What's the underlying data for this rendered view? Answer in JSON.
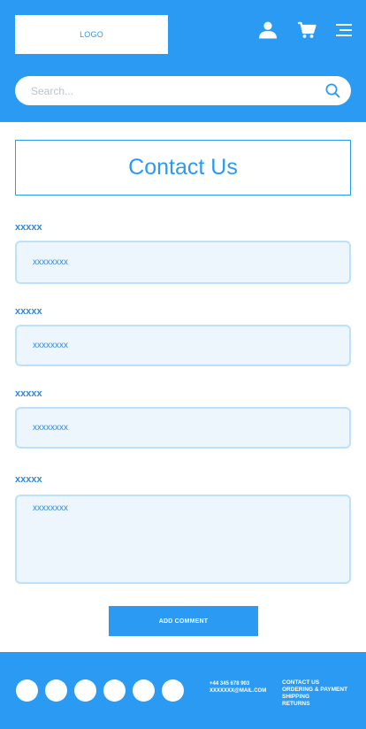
{
  "header": {
    "logo_text": "LOGO",
    "icons": [
      "user-icon",
      "cart-icon",
      "menu-icon"
    ],
    "search": {
      "placeholder": "Search..."
    }
  },
  "main": {
    "title": "Contact Us",
    "fields": [
      {
        "label": "xxxxx",
        "placeholder": "xxxxxxxx"
      },
      {
        "label": "xxxxx",
        "placeholder": "xxxxxxxx"
      },
      {
        "label": "xxxxx",
        "placeholder": "xxxxxxxx"
      },
      {
        "label": "xxxxx",
        "placeholder": "xxxxxxxx"
      }
    ],
    "submit_label": "ADD COMMENT"
  },
  "footer": {
    "social_icons": [
      "social-icon-1",
      "social-icon-2",
      "social-icon-3",
      "social-icon-4",
      "social-icon-5",
      "social-icon-6"
    ],
    "phone": "+44 345 678 903",
    "email": "XXXXXXX@MAIL.COM",
    "links": [
      "CONTACT US",
      "ORDERING & PAYMENT",
      "SHIPPING",
      "RETURNS"
    ]
  },
  "colors": {
    "primary": "#2b9af3",
    "field_background": "#eef6fd",
    "field_border": "#bde0fb",
    "text_accent": "#2b8ae0",
    "white": "#ffffff"
  }
}
